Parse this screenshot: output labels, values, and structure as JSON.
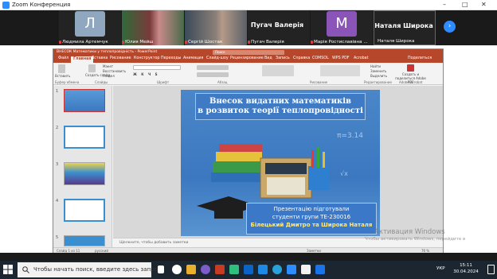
{
  "zoom": {
    "window_title": "Zoom Конференция",
    "participants": [
      {
        "name": "Людмила Артемчук",
        "letter": "Л",
        "color": "#8fa8c0",
        "muted": true
      },
      {
        "name": "Юлия Мейш",
        "muted": true
      },
      {
        "name": "Сергій Шостак",
        "muted": true
      },
      {
        "name": "Пугач Валерія",
        "big_name": "Пугач Валерія",
        "muted": true
      },
      {
        "name": "Марія Ростиславівна ...",
        "letter": "М",
        "color": "#8b54b8",
        "muted": true
      },
      {
        "name": "Наталя Широка",
        "big_name": "Наталя Широка",
        "muted": false
      }
    ]
  },
  "ppt": {
    "doc_title": "ВНЕСОК Математики у теплопровідність - PowerPoint",
    "search_placeholder": "Поиск",
    "tabs": [
      "Файл",
      "Главная",
      "Вставка",
      "Рисование",
      "Конструктор",
      "Переходы",
      "Анимация",
      "Слайд-шоу",
      "Рецензирование",
      "Вид",
      "Запись",
      "Справка",
      "COMSOL",
      "WPS PDF",
      "Acrobat"
    ],
    "active_tab": "Главная",
    "share_label": "Поделиться",
    "ribbon": {
      "paste": "Вставить",
      "create_slide": "Создать слайд",
      "layout": "Макет",
      "reset": "Восстановить",
      "section": "Раздел",
      "group_clipboard": "Буфер обмена",
      "group_slides": "Слайды",
      "group_font": "Шрифт",
      "group_paragraph": "Абзац",
      "group_drawing": "Рисование",
      "group_editing": "Редактирование",
      "find": "Найти",
      "replace": "Заменить",
      "select": "Выделить",
      "share_pdf": "Создать и поделиться Adobe PDF",
      "group_acrobat": "Adobe Acrobat"
    },
    "slide_numbers": [
      "1",
      "2",
      "3",
      "4",
      "5"
    ],
    "slide": {
      "title_line1": "Внесок видатних математиків",
      "title_line2": "в розвиток теорії теплопровідності",
      "caption_line1": "Презентацію підготували",
      "caption_line2": "студенти групи ТЕ-230016",
      "caption_line3": "Білецький Дмитро та Широка Наталя"
    },
    "notes_placeholder": "Щелкните, чтобы добавить заметки",
    "status_left": "Слайд 1 из 11",
    "status_lang": "русский",
    "status_notes": "Заметки",
    "status_zoom": "76 %"
  },
  "windows": {
    "activation_title": "Активация Windows",
    "activation_sub": "Чтобы активировать Windows, перейдите в",
    "search_text": "Чтобы начать поиск, введите здесь запрос",
    "lang": "УКР",
    "time": "15:11",
    "date": "30.04.2024"
  }
}
